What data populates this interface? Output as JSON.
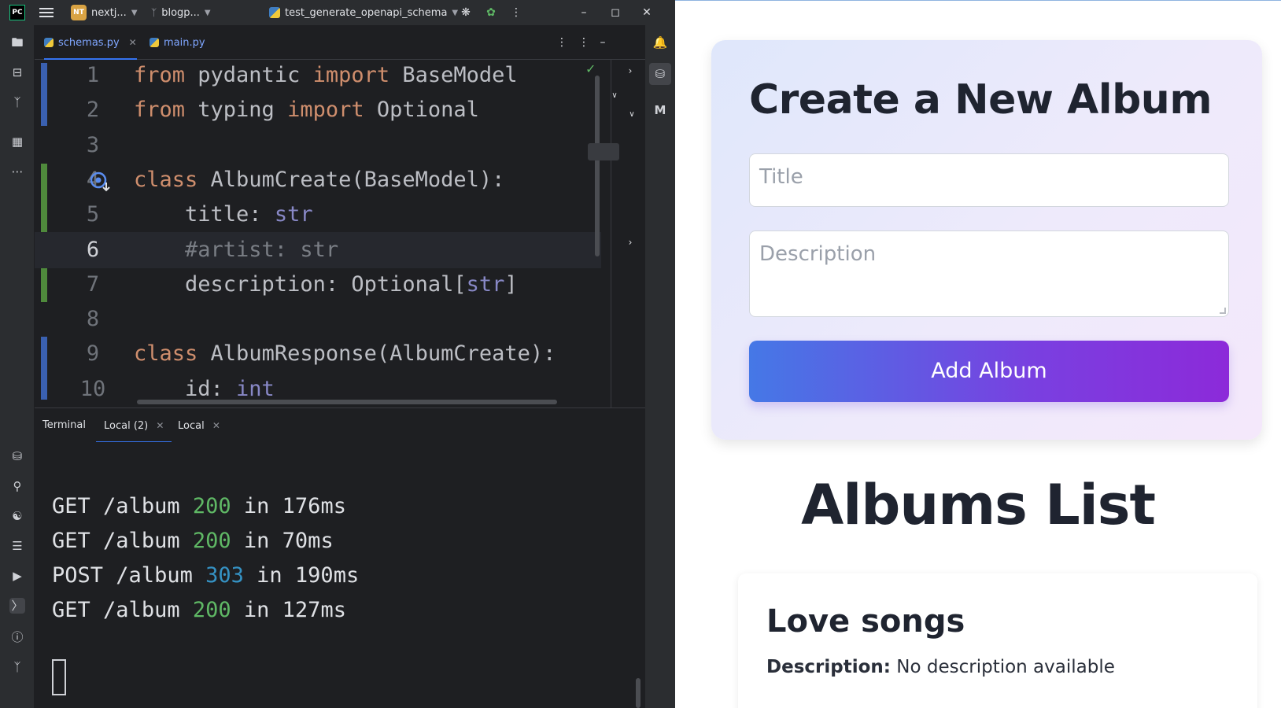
{
  "ide": {
    "logo": "PC",
    "project": {
      "badge": "NT",
      "name": "nextj..."
    },
    "branch": "blogp...",
    "run_config": "test_generate_openapi_schema",
    "tabs": [
      {
        "label": "schemas.py",
        "active": true
      },
      {
        "label": "main.py",
        "active": false
      }
    ],
    "code_lines": [
      {
        "n": "1",
        "parts": [
          [
            "kw",
            "from "
          ],
          [
            "tx",
            "pydantic "
          ],
          [
            "kw",
            "import "
          ],
          [
            "tx",
            "BaseModel"
          ]
        ]
      },
      {
        "n": "2",
        "parts": [
          [
            "kw",
            "from "
          ],
          [
            "tx",
            "typing "
          ],
          [
            "kw",
            "import "
          ],
          [
            "tx",
            "Optional"
          ]
        ]
      },
      {
        "n": "3",
        "parts": []
      },
      {
        "n": "4",
        "parts": [
          [
            "kw",
            "class "
          ],
          [
            "tx",
            "AlbumCreate(BaseModel):"
          ]
        ]
      },
      {
        "n": "5",
        "parts": [
          [
            "tx",
            "    title: "
          ],
          [
            "ty",
            "str"
          ]
        ]
      },
      {
        "n": "6",
        "parts": [
          [
            "cm",
            "    #artist: str"
          ]
        ],
        "current": true
      },
      {
        "n": "7",
        "parts": [
          [
            "tx",
            "    description: Optional["
          ],
          [
            "ty",
            "str"
          ],
          [
            "tx",
            "]"
          ]
        ]
      },
      {
        "n": "8",
        "parts": []
      },
      {
        "n": "9",
        "parts": [
          [
            "kw",
            "class "
          ],
          [
            "tx",
            "AlbumResponse(AlbumCreate):"
          ]
        ]
      },
      {
        "n": "10",
        "parts": [
          [
            "tx",
            "    id: "
          ],
          [
            "ty",
            "int"
          ]
        ]
      }
    ],
    "terminal": {
      "tabs": [
        {
          "label": "Terminal",
          "closable": false,
          "active": false
        },
        {
          "label": "Local (2)",
          "closable": true,
          "active": true
        },
        {
          "label": "Local",
          "closable": true,
          "active": false
        }
      ],
      "lines": [
        {
          "method": "GET",
          "path": "/album",
          "status": "200",
          "status_kind": "ok",
          "timing": "in 176ms"
        },
        {
          "method": "GET",
          "path": "/album",
          "status": "200",
          "status_kind": "ok",
          "timing": "in 70ms"
        },
        {
          "method": "POST",
          "path": "/album",
          "status": "303",
          "status_kind": "redirect",
          "timing": "in 190ms"
        },
        {
          "method": "GET",
          "path": "/album",
          "status": "200",
          "status_kind": "ok",
          "timing": "in 127ms"
        }
      ]
    }
  },
  "app": {
    "form_title": "Create a New Album",
    "title_placeholder": "Title",
    "description_placeholder": "Description",
    "submit_label": "Add Album",
    "list_title": "Albums List",
    "albums": [
      {
        "name": "Love songs",
        "description_label": "Description:",
        "description": "No description available"
      }
    ]
  },
  "colors": {
    "keyword": "#cf8e6d",
    "builtin_type": "#8888c6",
    "comment": "#7a7e85",
    "status_ok": "#5fb865",
    "status_redirect": "#3592c4",
    "button_gradient_start": "#4578e6",
    "button_gradient_end": "#8c2ad9"
  }
}
